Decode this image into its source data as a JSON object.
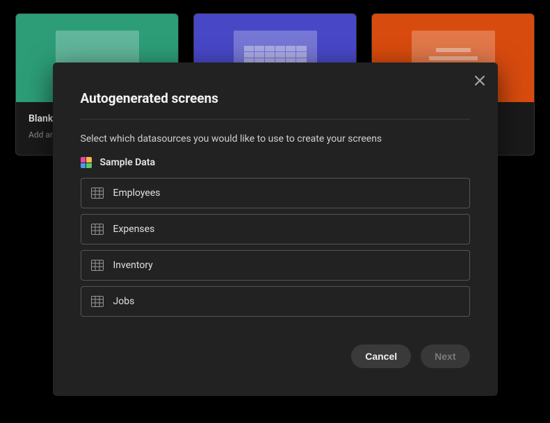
{
  "cards": [
    {
      "title": "Blank",
      "sub": "Add an"
    }
  ],
  "modal": {
    "title": "Autogenerated screens",
    "subtitle": "Select which datasources you would like to use to create your screens",
    "datasource_name": "Sample Data",
    "options": [
      {
        "label": "Employees"
      },
      {
        "label": "Expenses"
      },
      {
        "label": "Inventory"
      },
      {
        "label": "Jobs"
      }
    ],
    "cancel_label": "Cancel",
    "next_label": "Next"
  }
}
